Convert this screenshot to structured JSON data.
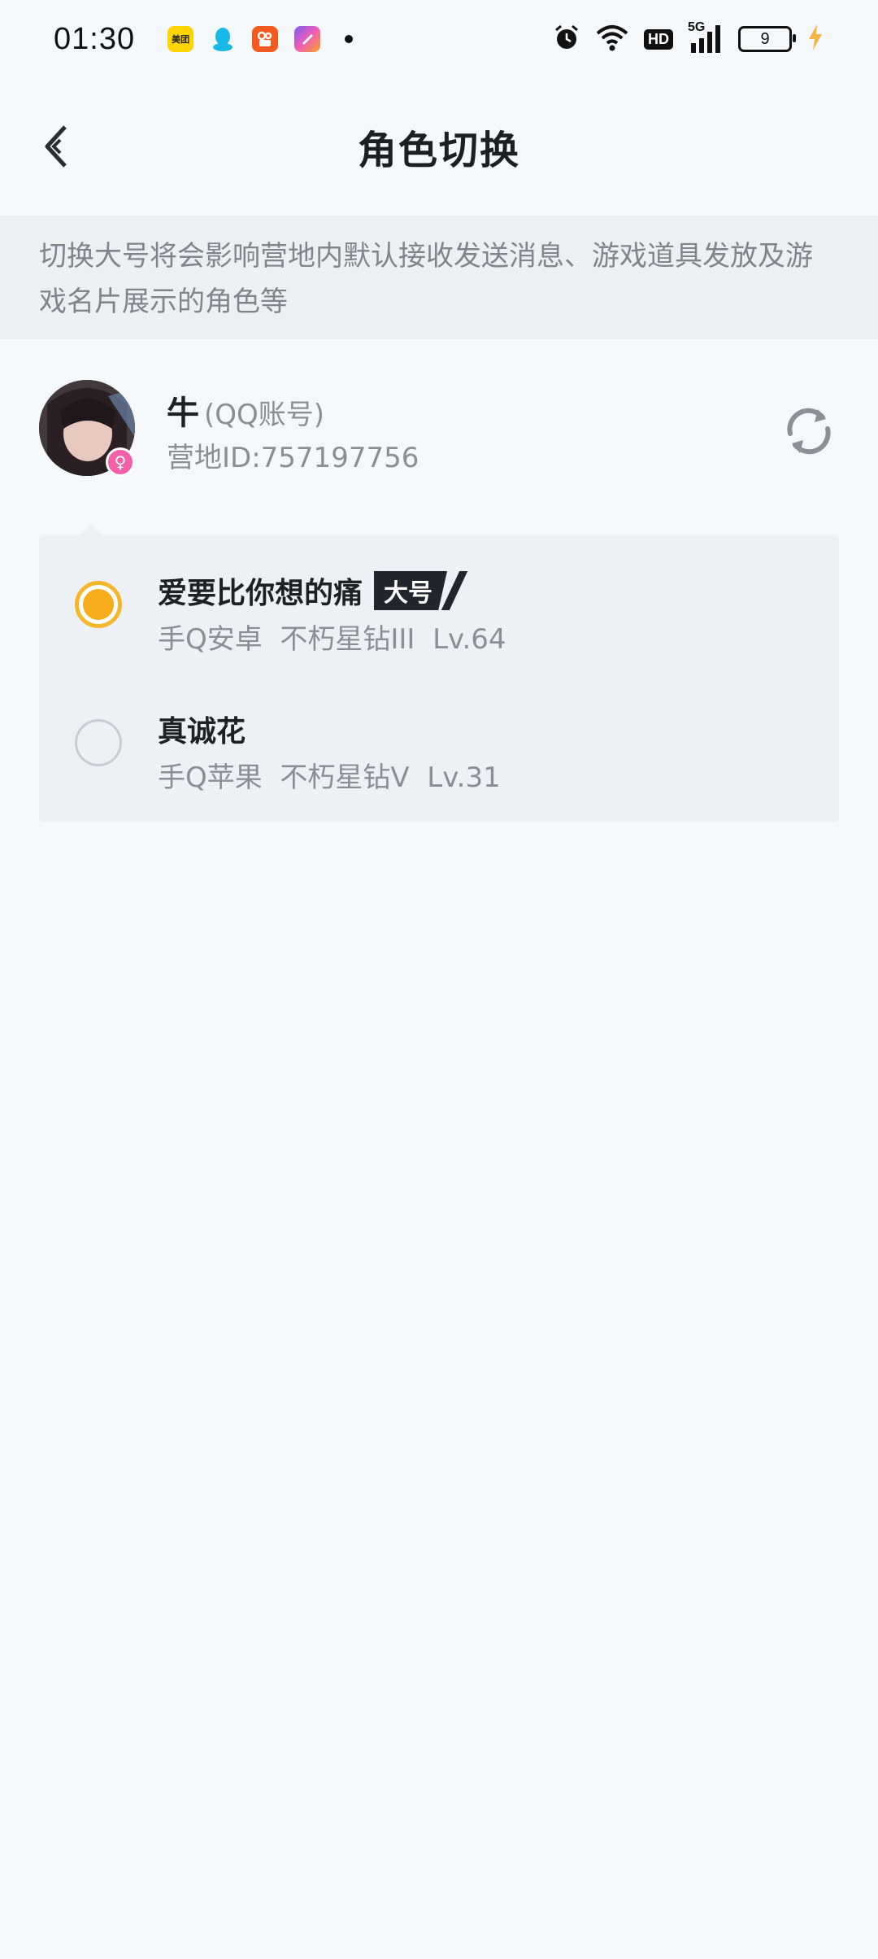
{
  "status_bar": {
    "time": "01:30",
    "apps": [
      "美团",
      "QQ",
      "快手",
      "app"
    ],
    "hd": "HD",
    "network": "5G",
    "battery": "9"
  },
  "header": {
    "title": "角色切换"
  },
  "notice": {
    "text": "切换大号将会影响营地内默认接收发送消息、游戏道具发放及游戏名片展示的角色等"
  },
  "account": {
    "name": "牛",
    "type": "(QQ账号)",
    "camp_id": "营地ID:757197756"
  },
  "roles": [
    {
      "name": "爱要比你想的痛",
      "badge": "大号",
      "meta": "手Q安卓  不朽星钻III  Lv.64",
      "selected": true
    },
    {
      "name": "真诚花",
      "meta": "手Q苹果  不朽星钻V  Lv.31",
      "selected": false
    }
  ],
  "colors": {
    "accent": "#f6ab18",
    "background": "#f5f8fb",
    "notice_bg": "#edf0f3",
    "badge_bg": "#21262d"
  }
}
